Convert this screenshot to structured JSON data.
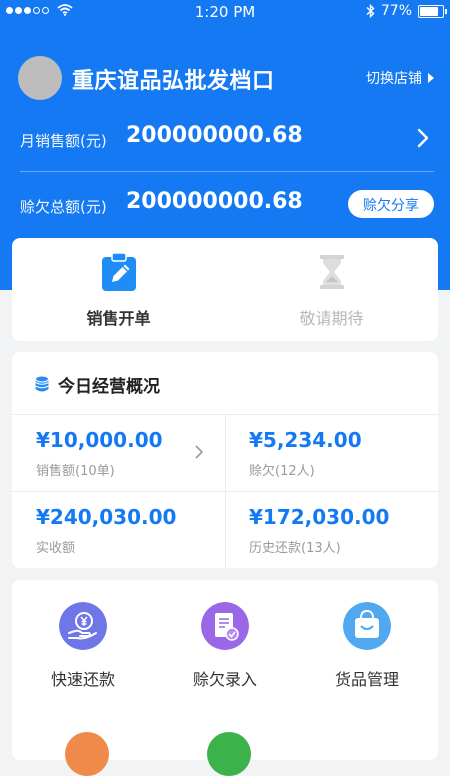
{
  "status_bar": {
    "time": "1:20 PM",
    "battery": "77%",
    "battery_level": 0.77
  },
  "header": {
    "shop_name": "重庆谊品弘批发档口",
    "switch_shop": "切换店铺",
    "monthly_sales_label": "月销售额(元)",
    "monthly_sales_value": "200000000.68",
    "total_credit_label": "赊欠总额(元)",
    "total_credit_value": "200000000.68",
    "credit_share_button": "赊欠分享"
  },
  "actions": [
    {
      "label": "销售开单",
      "icon": "clipboard-pen-icon",
      "enabled": true
    },
    {
      "label": "敬请期待",
      "icon": "hourglass-icon",
      "enabled": false
    }
  ],
  "overview": {
    "title": "今日经营概况",
    "icon": "coin-stack-icon",
    "cells": [
      {
        "value": "¥10,000.00",
        "label": "销售额(10单)"
      },
      {
        "value": "¥5,234.00",
        "label": "赊欠(12人)"
      },
      {
        "value": "¥240,030.00",
        "label": "实收额"
      },
      {
        "value": "¥172,030.00",
        "label": "历史还款(13人)"
      }
    ]
  },
  "features": [
    {
      "label": "快速还款",
      "icon": "yen-hand-icon",
      "color": "#6f76e8"
    },
    {
      "label": "赊欠录入",
      "icon": "document-check-icon",
      "color": "#9a68e6"
    },
    {
      "label": "货品管理",
      "icon": "shopping-bag-icon",
      "color": "#4fa8f0"
    }
  ],
  "colors": {
    "primary": "#1479f2",
    "background": "#f2f3f5",
    "muted_text": "#9a9a9a"
  }
}
